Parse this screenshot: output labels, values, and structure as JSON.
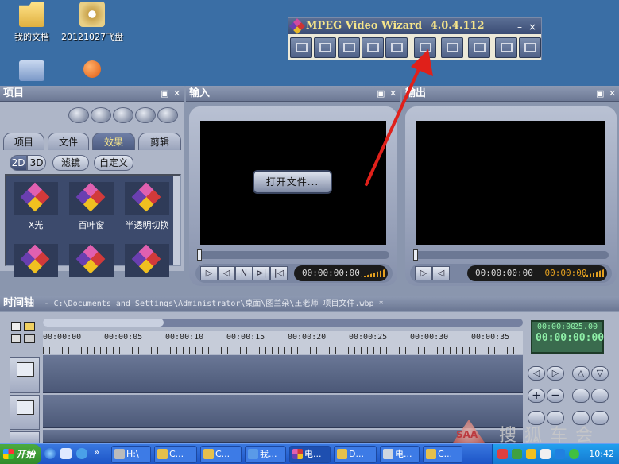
{
  "desktop": {
    "icons": [
      {
        "label": "我的文档",
        "icon": "folder-icon"
      },
      {
        "label": "20121027飞盘",
        "icon": "dvd-icon"
      },
      {
        "label": "",
        "icon": "network-icon"
      },
      {
        "label": "",
        "icon": "shortcut-icon"
      }
    ]
  },
  "wizard": {
    "title": "MPEG Video Wizard",
    "version": "4.0.4.112",
    "minimize": "–",
    "close": "×"
  },
  "project_panel": {
    "title": "项目",
    "tabs": [
      "项目",
      "文件",
      "效果",
      "剪辑"
    ],
    "active_tab": "效果",
    "filters": [
      "2D",
      "3D",
      "滤镜",
      "自定义"
    ],
    "effects": [
      {
        "label": "X光"
      },
      {
        "label": "百叶窗"
      },
      {
        "label": "半透明切换"
      },
      {
        "label": ""
      },
      {
        "label": ""
      },
      {
        "label": ""
      }
    ]
  },
  "input_panel": {
    "title": "输入",
    "open_file": "打开文件...",
    "timecode": "00:00:00:00",
    "controls": [
      "▷",
      "◁",
      "N",
      "⊳|",
      "|◁"
    ]
  },
  "output_panel": {
    "title": "输出",
    "timecode": "00:00:00:00",
    "timecode_alt": "00:00:00",
    "controls": [
      "▷",
      "◁"
    ]
  },
  "timeline": {
    "title": "时间轴",
    "path": "- C:\\Documents and Settings\\Administrator\\桌面\\图兰朵\\王老师 项目文件.wbp *",
    "ticks": [
      "00:00:00",
      "00:00:05",
      "00:00:10",
      "00:00:15",
      "00:00:20",
      "00:00:25",
      "00:00:30",
      "00:00:35"
    ],
    "lcd_top_left": "00:00:00",
    "lcd_top_right": "25.00",
    "lcd_main": "00:00:00:00",
    "buttons": {
      "plus": "+",
      "minus": "−"
    }
  },
  "taskbar": {
    "start_label": "开始",
    "items": [
      "H:\\",
      "C...",
      "C...",
      "我...",
      "电...",
      "D...",
      "电...",
      "C..."
    ],
    "clock": "10:42"
  },
  "watermark": {
    "logo": "SAA",
    "text": "搜狐车会"
  },
  "colors": {
    "desktop": "#3a6ea5",
    "app_bg": "#8a96ae",
    "accent_yellow": "#f6e58a",
    "timecode_orange": "#e3a020",
    "arrow_red": "#e0201a"
  }
}
